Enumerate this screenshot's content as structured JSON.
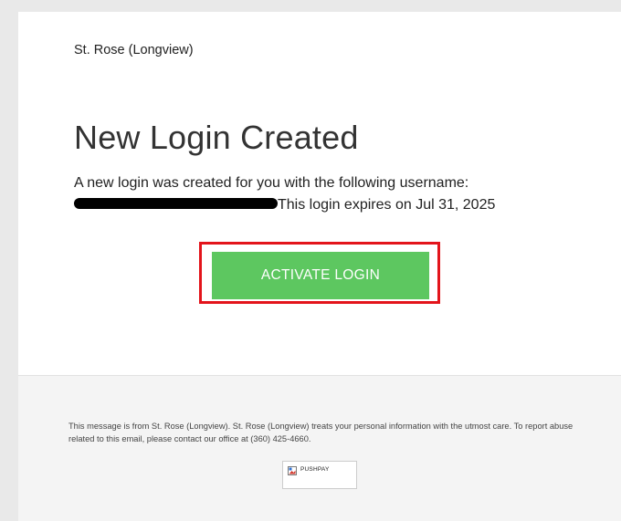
{
  "email": {
    "org_name": "St. Rose (Longview)",
    "headline": "New Login Created",
    "body_line1": "A new login was created for you with the following username:",
    "body_line2_suffix": "This login expires on Jul 31, 2025",
    "activate_label": "ACTIVATE LOGIN"
  },
  "footer": {
    "message": "This message is from St. Rose (Longview). St. Rose (Longview) treats your personal information with the utmost care. To report abuse related to this email, please contact our office at (360) 425-4660.",
    "logo_alt": "PUSHPAY"
  },
  "colors": {
    "button_bg": "#5dc760",
    "highlight_border": "#e3141b",
    "background": "#e9e9e9",
    "footer_bg": "#f4f4f4"
  },
  "icons": {
    "broken_image": "broken-image-icon"
  }
}
